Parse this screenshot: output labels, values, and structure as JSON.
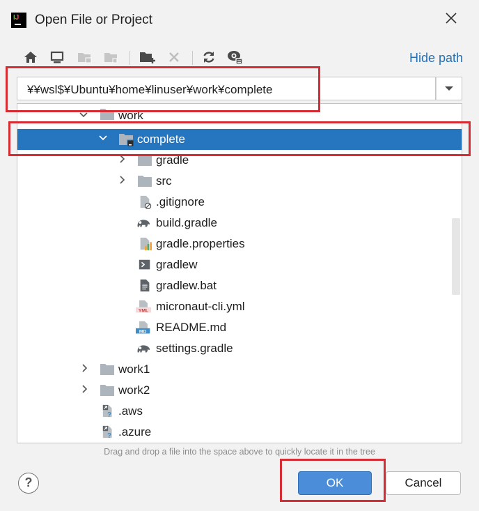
{
  "window": {
    "title": "Open File or Project"
  },
  "toolbar": {
    "icons": [
      "home-icon",
      "desktop-icon",
      "project-folder-icon",
      "module-folder-icon",
      "new-folder-icon",
      "delete-icon",
      "refresh-icon",
      "show-hidden-icon"
    ],
    "hide_path_label": "Hide path"
  },
  "path": {
    "value": "¥¥wsl$¥Ubuntu¥home¥linuser¥work¥complete"
  },
  "tree": {
    "items": [
      {
        "label": "work",
        "icon": "folder-icon",
        "expanded": true
      },
      {
        "label": "complete",
        "icon": "folder-icon",
        "expanded": true,
        "selected": true
      },
      {
        "label": "gradle",
        "icon": "folder-icon",
        "expanded": false
      },
      {
        "label": "src",
        "icon": "folder-icon",
        "expanded": false
      },
      {
        "label": ".gitignore",
        "icon": "ignore-file-icon"
      },
      {
        "label": "build.gradle",
        "icon": "gradle-elephant-icon"
      },
      {
        "label": "gradle.properties",
        "icon": "properties-file-icon"
      },
      {
        "label": "gradlew",
        "icon": "shell-script-icon"
      },
      {
        "label": "gradlew.bat",
        "icon": "text-file-icon"
      },
      {
        "label": "micronaut-cli.yml",
        "icon": "yml-file-icon",
        "badge": "YML"
      },
      {
        "label": "README.md",
        "icon": "markdown-file-icon",
        "badge": "MD"
      },
      {
        "label": "settings.gradle",
        "icon": "gradle-elephant-icon"
      },
      {
        "label": "work1",
        "icon": "folder-icon",
        "expanded": false
      },
      {
        "label": "work2",
        "icon": "folder-icon",
        "expanded": false
      },
      {
        "label": ".aws",
        "icon": "unknown-link-icon"
      },
      {
        "label": ".azure",
        "icon": "unknown-link-icon"
      }
    ]
  },
  "hint": "Drag and drop a file into the space above to quickly locate it in the tree",
  "buttons": {
    "help": "?",
    "ok": "OK",
    "cancel": "Cancel"
  },
  "colors": {
    "selection": "#2675bf",
    "link": "#2470b3",
    "highlight": "#d52d33",
    "ok": "#4b8dd8"
  }
}
